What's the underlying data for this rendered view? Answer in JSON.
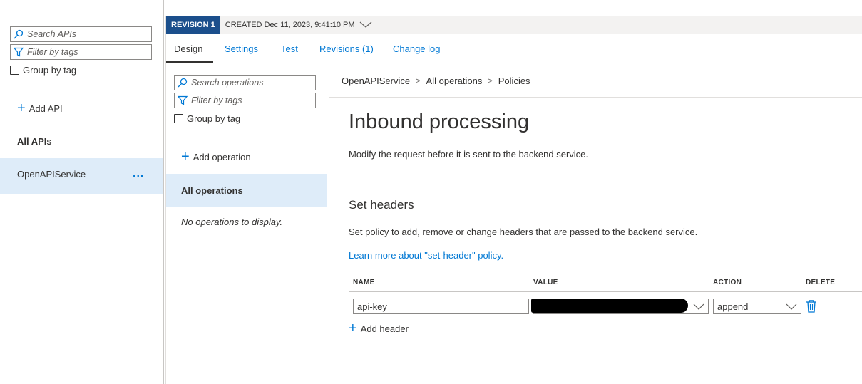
{
  "api_panel": {
    "search_placeholder": "Search APIs",
    "filter_placeholder": "Filter by tags",
    "group_by_tag": "Group by tag",
    "add_api": "Add API",
    "all_apis": "All APIs",
    "selected_api": "OpenAPIService",
    "more_actions": "..."
  },
  "revision": {
    "badge": "REVISION 1",
    "created": "CREATED Dec 11, 2023, 9:41:10 PM"
  },
  "tabs": [
    {
      "label": "Design"
    },
    {
      "label": "Settings"
    },
    {
      "label": "Test"
    },
    {
      "label": "Revisions (1)"
    },
    {
      "label": "Change log"
    }
  ],
  "operations_panel": {
    "search_placeholder": "Search operations",
    "filter_placeholder": "Filter by tags",
    "group_by_tag": "Group by tag",
    "add_operation": "Add operation",
    "all_operations": "All operations",
    "empty_message": "No operations to display."
  },
  "breadcrumb": [
    "OpenAPIService",
    "All operations",
    "Policies"
  ],
  "breadcrumb_sep": ">",
  "main": {
    "title": "Inbound processing",
    "description": "Modify the request before it is sent to the backend service.",
    "section_title": "Set headers",
    "section_description": "Set policy to add, remove or change headers that are passed to the backend service.",
    "learn_more": "Learn more about \"set-header\" policy."
  },
  "headers_table": {
    "columns": [
      "NAME",
      "VALUE",
      "ACTION",
      "DELETE"
    ],
    "rows": [
      {
        "name": "api-key",
        "value": "",
        "action": "append"
      }
    ],
    "add_header": "Add header"
  },
  "colors": {
    "accent": "#0078d4",
    "revision_badge": "#1b4f8c",
    "selected": "#deecf9"
  }
}
